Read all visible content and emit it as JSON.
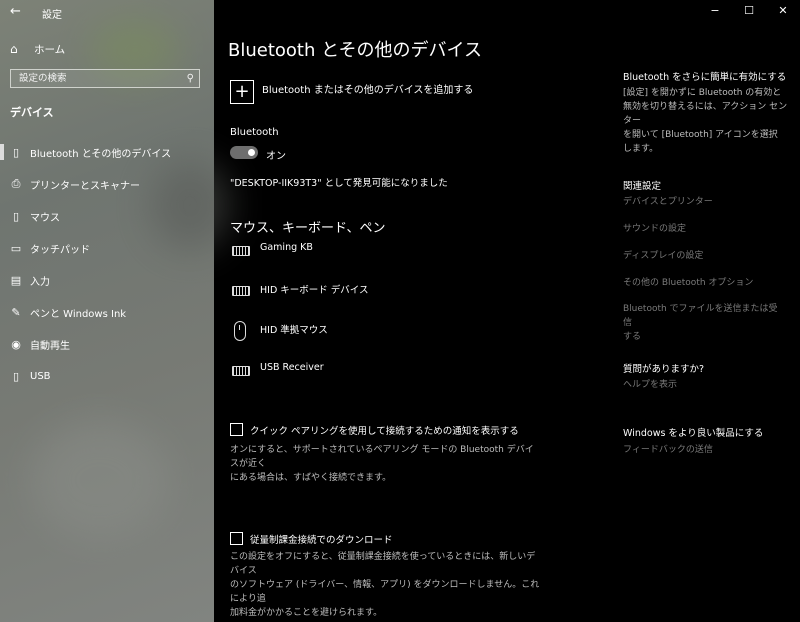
{
  "app": {
    "title": "設定",
    "back_icon": "back-arrow-icon"
  },
  "sidebar": {
    "home_label": "ホーム",
    "search_placeholder": "設定の検索",
    "section_title": "デバイス",
    "items": [
      {
        "label": "Bluetooth とその他のデバイス",
        "icon": "bluetooth-devices-icon",
        "active": true
      },
      {
        "label": "プリンターとスキャナー",
        "icon": "printer-icon",
        "active": false
      },
      {
        "label": "マウス",
        "icon": "mouse-icon",
        "active": false
      },
      {
        "label": "タッチパッド",
        "icon": "touchpad-icon",
        "active": false
      },
      {
        "label": "入力",
        "icon": "keyboard-icon",
        "active": false
      },
      {
        "label": "ペンと Windows Ink",
        "icon": "pen-icon",
        "active": false
      },
      {
        "label": "自動再生",
        "icon": "autoplay-icon",
        "active": false
      },
      {
        "label": "USB",
        "icon": "usb-icon",
        "active": false
      }
    ]
  },
  "window_controls": {
    "minimize": "−",
    "maximize": "☐",
    "close": "✕"
  },
  "main": {
    "title": "Bluetooth とその他のデバイス",
    "add_device_label": "Bluetooth またはその他のデバイスを追加する",
    "bluetooth_label": "Bluetooth",
    "toggle_state": "オン",
    "toggle_on": true,
    "discoverable_text": "\"DESKTOP-IIK93T3\" として発見可能になりました",
    "devices_heading": "マウス、キーボード、ペン",
    "devices": [
      {
        "name": "Gaming KB",
        "type": "keyboard"
      },
      {
        "name": "HID キーボード デバイス",
        "type": "keyboard"
      },
      {
        "name": "HID 準拠マウス",
        "type": "mouse"
      },
      {
        "name": "USB Receiver",
        "type": "keyboard"
      }
    ],
    "swift_pair": {
      "label": "クイック ペアリングを使用して接続するための通知を表示する",
      "desc_line1": "オンにすると、サポートされているペアリング モードの Bluetooth デバイスが近く",
      "desc_line2": "にある場合は、すばやく接続できます。",
      "checked": false
    },
    "metered": {
      "label": "従量制課金接続でのダウンロード",
      "desc_line1": "この設定をオフにすると、従量制課金接続を使っているときには、新しいデバイス",
      "desc_line2": "のソフトウェア (ドライバー、情報、アプリ) をダウンロードしません。これにより追",
      "desc_line3": "加料金がかかることを避けられます。",
      "checked": false
    }
  },
  "right": {
    "tip_heading": "Bluetooth をさらに簡単に有効にする",
    "tip_line1": "[設定] を開かずに Bluetooth の有効と",
    "tip_line2": "無効を切り替えるには、アクション センター",
    "tip_line3": "を開いて [Bluetooth] アイコンを選択",
    "tip_line4": "します。",
    "related_heading": "関連設定",
    "related_links": [
      "デバイスとプリンター",
      "サウンドの設定",
      "ディスプレイの設定",
      "その他の Bluetooth オプション"
    ],
    "send_files_line1": "Bluetooth でファイルを送信または受信",
    "send_files_line2": "する",
    "question_heading": "質問がありますか?",
    "help_link": "ヘルプを表示",
    "better_heading": "Windows をより良い製品にする",
    "feedback_link": "フィードバックの送信"
  }
}
